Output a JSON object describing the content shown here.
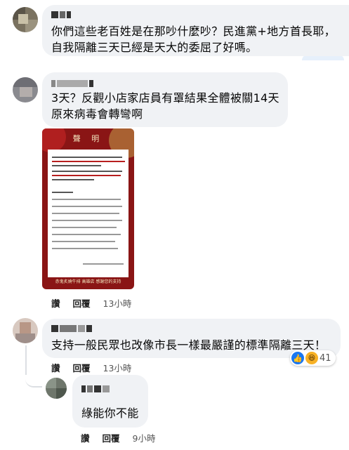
{
  "comments": [
    {
      "text_lines": [
        "你們這些老百姓是在那吵什麼吵？民進黨+地方首長耶，",
        "自我隔離三天已經是天大的委屈了好嗎。"
      ]
    },
    {
      "text_lines": [
        "3天？反觀小店家店員有罩結果全體被關14天",
        "原來病毒會轉彎啊"
      ],
      "image": {
        "title": "聲 明",
        "footer": "赤鬼炙燒牛排 高雄店 感謝您的支持"
      },
      "actions": {
        "like": "讚",
        "reply": "回覆",
        "time": "13小時"
      }
    },
    {
      "text_lines": [
        "支持一般民眾也改像市長一樣最嚴謹的標準隔離三天！"
      ],
      "actions": {
        "like": "讚",
        "reply": "回覆",
        "time": "13小時"
      },
      "reactions": {
        "count": "41",
        "icons": [
          "like-icon",
          "haha-icon"
        ]
      }
    },
    {
      "text_lines": [
        "綠能你不能"
      ],
      "actions": {
        "like": "讚",
        "reply": "回覆",
        "time": "9小時"
      }
    }
  ]
}
